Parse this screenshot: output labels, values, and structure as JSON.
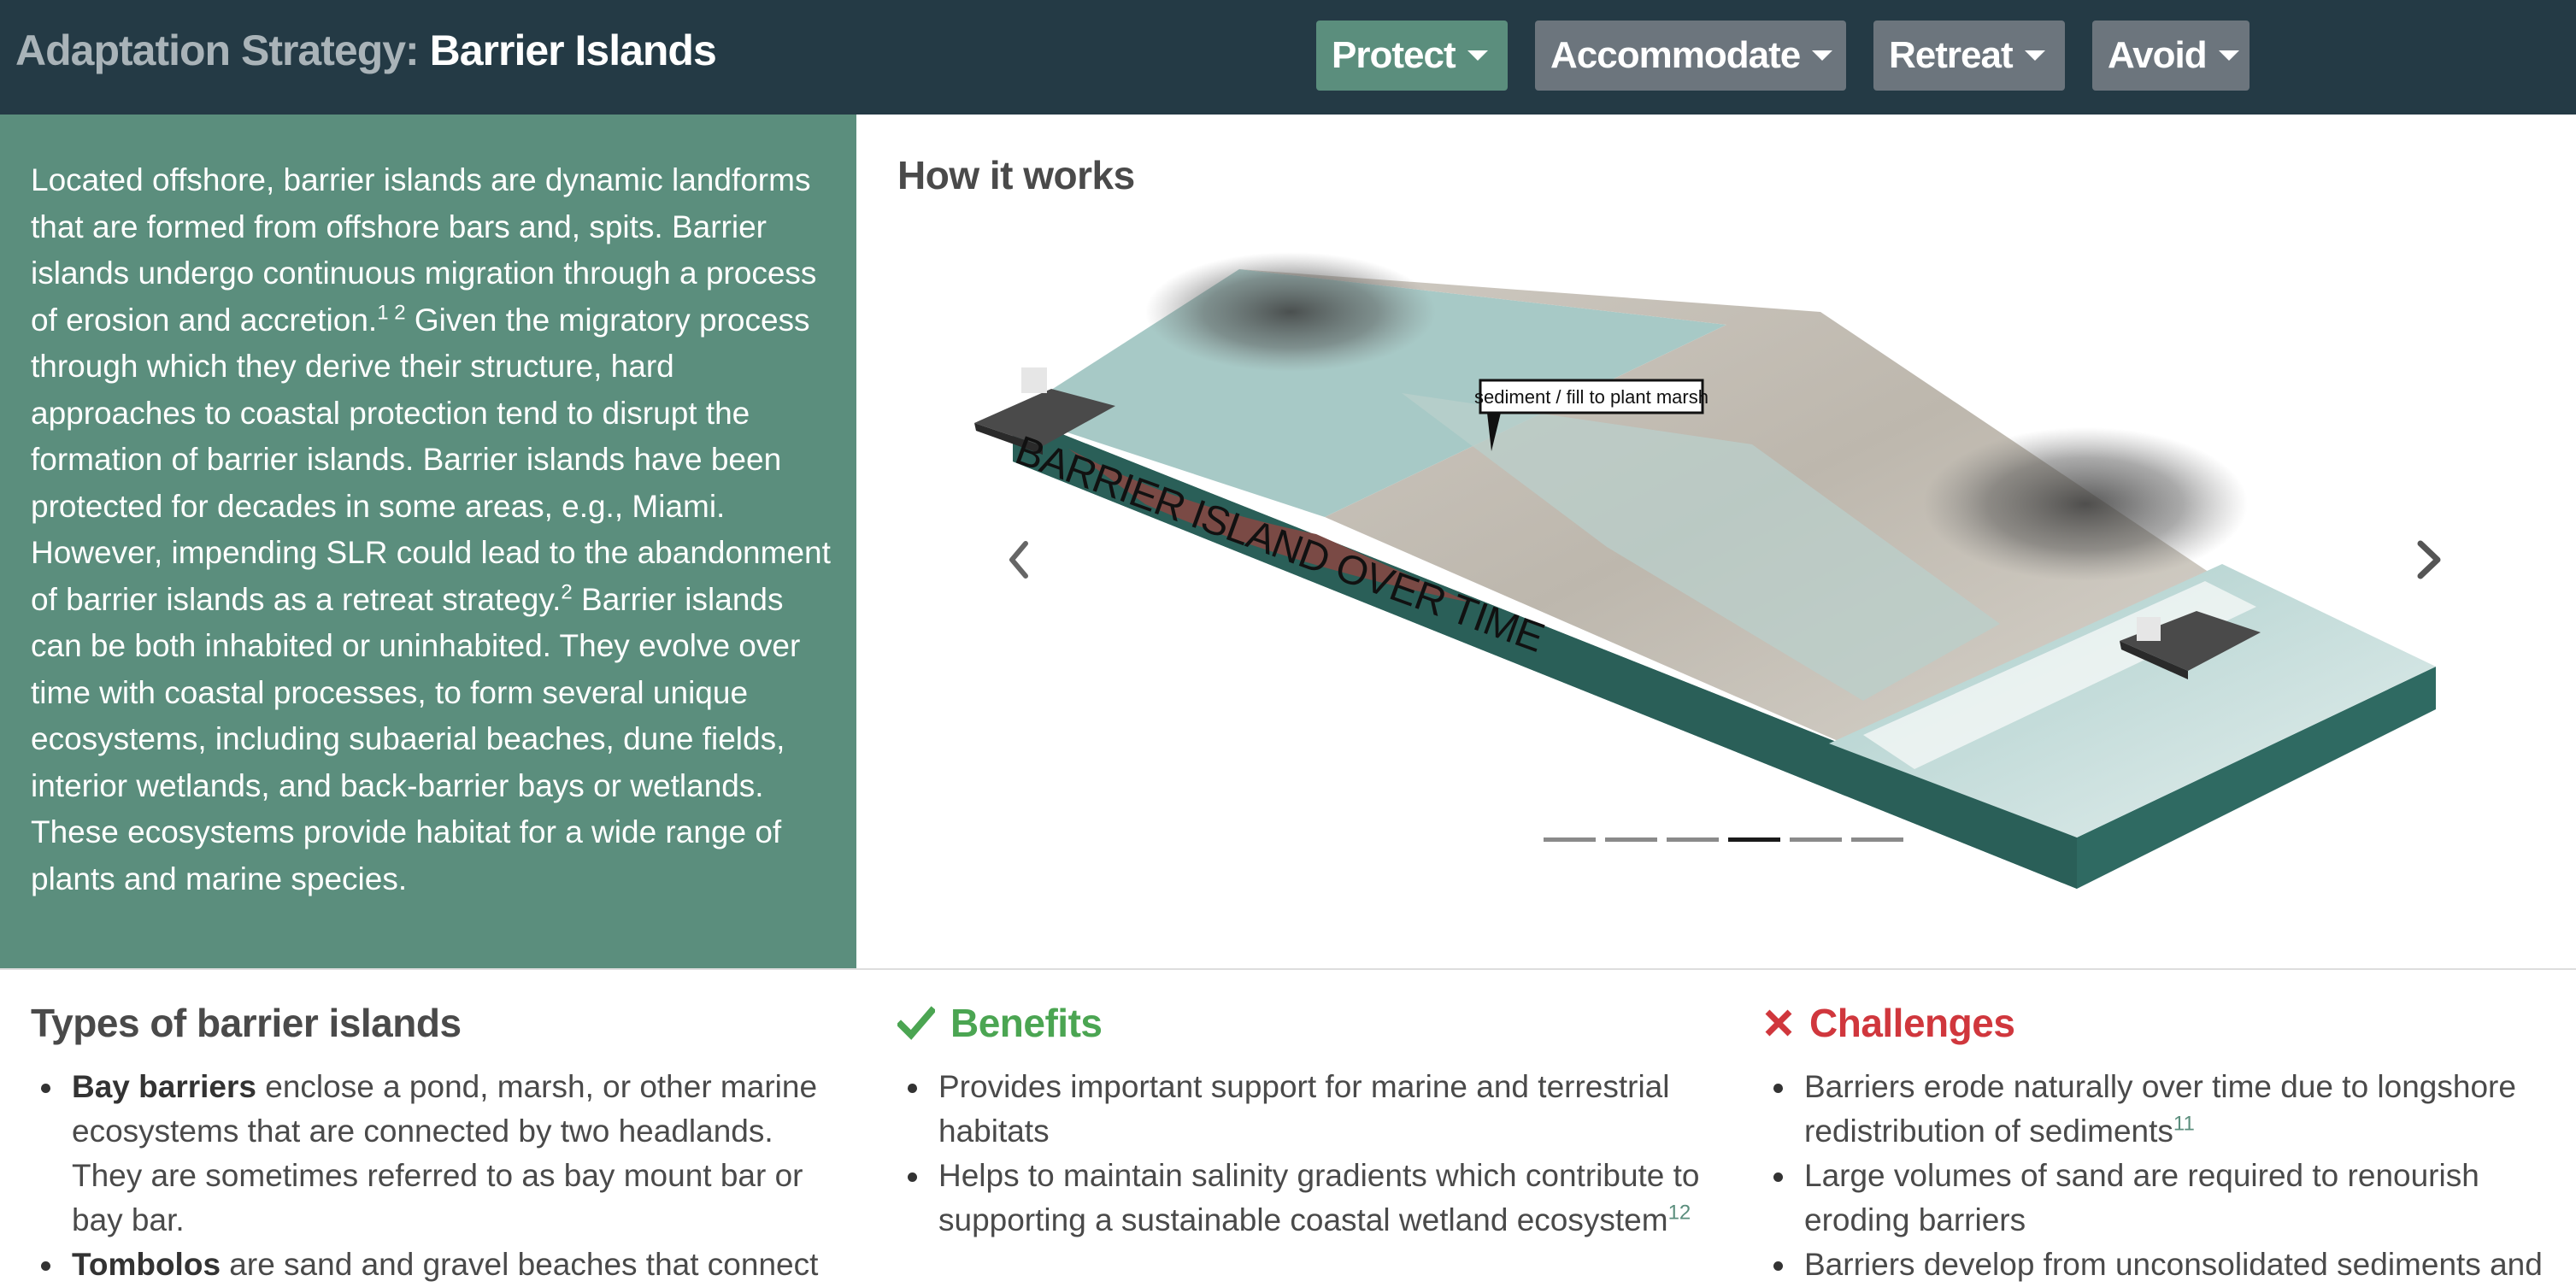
{
  "header": {
    "title_prefix": "Adaptation Strategy:",
    "title_name": "Barrier Islands",
    "nav": [
      {
        "label": "Protect"
      },
      {
        "label": "Accommodate"
      },
      {
        "label": "Retreat"
      },
      {
        "label": "Avoid"
      }
    ]
  },
  "intro": {
    "part1": "Located offshore, barrier islands are dynamic landforms that are formed from offshore bars and, spits. Barrier islands undergo continuous migration through a process of erosion and accretion.",
    "ref1": "1 2",
    "part2": " Given the migratory process through which they derive their structure, hard approaches to coastal protection tend to disrupt the formation of barrier islands. Barrier islands have been protected for decades in some areas, e.g., Miami. However, impending SLR could lead to the abandonment of barrier islands as a retreat strategy.",
    "ref2": "2",
    "part3": " Barrier islands can be both inhabited or uninhabited. They evolve over time with coastal processes, to form several unique ecosystems, including subaerial beaches, dune fields, interior wetlands, and back-barrier bays or wetlands. These ecosystems provide habitat for a wide range of plants and marine species."
  },
  "how_it_works": {
    "title": "How it works",
    "illustration": {
      "caption": "BARRIER ISLAND OVER TIME",
      "callout": "sediment / fill to plant marsh"
    },
    "slide_count": 6,
    "active_slide": 4
  },
  "types": {
    "title": "Types of barrier islands",
    "items": [
      {
        "term": "Bay barriers",
        "text": " enclose a pond, marsh, or other marine ecosystems that are connected by two headlands. They are sometimes referred to as bay mount bar or bay bar."
      },
      {
        "term": "Tombolos",
        "text": " are sand and gravel beaches that connect"
      }
    ]
  },
  "benefits": {
    "title": "Benefits",
    "items": [
      {
        "text": "Provides important support for marine and terrestrial habitats",
        "ref": ""
      },
      {
        "text": "Helps to maintain salinity gradients which contribute to supporting a sustainable coastal wetland ecosystem",
        "ref": "12"
      }
    ]
  },
  "challenges": {
    "title": "Challenges",
    "items": [
      {
        "text": "Barriers erode naturally over time due to longshore redistribution of sediments",
        "ref": "11"
      },
      {
        "text": "Large volumes of sand are required to renourish eroding barriers",
        "ref": ""
      },
      {
        "text": "Barriers develop from unconsolidated sediments and",
        "ref": ""
      }
    ]
  },
  "colors": {
    "header_bg": "#243a45",
    "accent_green": "#5b8e7d",
    "nav_gray": "#6c757d",
    "benefit_green": "#4ba552",
    "challenge_red": "#d0373d"
  }
}
